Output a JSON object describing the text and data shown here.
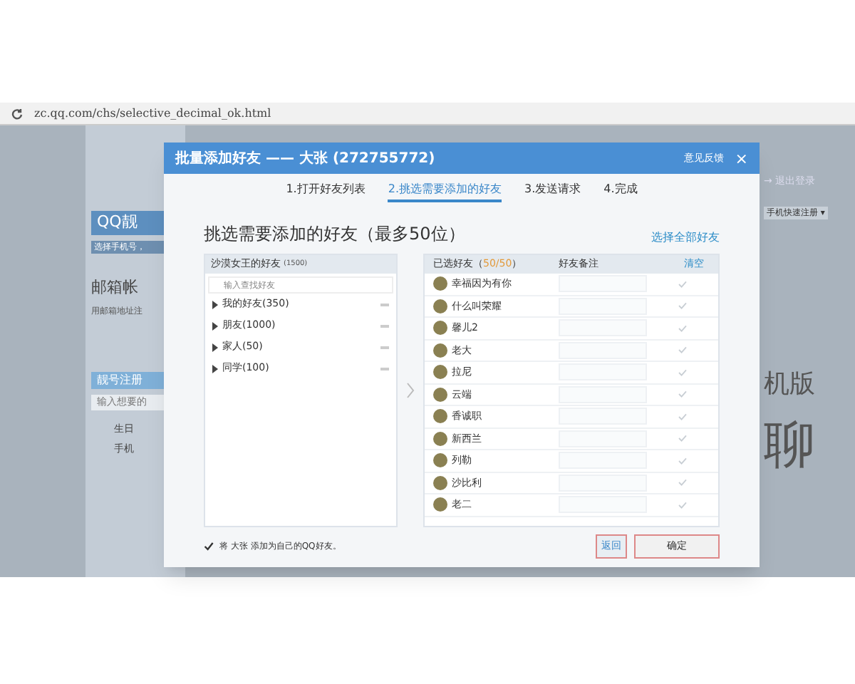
{
  "browser": {
    "url": "zc.qq.com/chs/selective_decimal_ok.html"
  },
  "background": {
    "left_title": "QQ靓",
    "left_sub": "选择手机号，",
    "mail_title": "邮箱帐",
    "mail_sub": "用邮箱地址注",
    "section": "靓号注册",
    "input_placeholder": "输入想要的",
    "birthday": "生日",
    "phone": "手机",
    "logout": "→ 退出登录",
    "phone_register": "手机快速注册 ▾",
    "promo_1": "机版",
    "promo_2": "聊"
  },
  "dialog": {
    "title": "批量添加好友 —— 大张 (272755772)",
    "feedback": "意见反馈",
    "close": "×",
    "steps": [
      {
        "label": "1.打开好友列表",
        "selected": false
      },
      {
        "label": "2.挑选需要添加的好友",
        "selected": true
      },
      {
        "label": "3.发送请求",
        "selected": false
      },
      {
        "label": "4.完成",
        "selected": false
      }
    ],
    "heading": "挑选需要添加的好友（最多50位）",
    "select_all": "选择全部好友",
    "left_panel": {
      "header": "沙漠女王的好友",
      "count": "(1500)",
      "search_placeholder": "输入查找好友",
      "groups": [
        {
          "label": "我的好友(350)",
          "expanded": false
        },
        {
          "label": "朋友(1000)",
          "expanded": false
        },
        {
          "label": "家人(50)",
          "expanded": false
        },
        {
          "label": "同学(100)",
          "expanded": false
        }
      ]
    },
    "right_panel": {
      "header_prefix": "已选好友（",
      "header_count": "50/50",
      "header_suffix": "）",
      "remark_column": "好友备注",
      "clear": "清空",
      "friends": [
        {
          "name": "幸福因为有你"
        },
        {
          "name": "什么叫荣耀"
        },
        {
          "name": "馨儿2"
        },
        {
          "name": "老大"
        },
        {
          "name": "拉尼"
        },
        {
          "name": "云端"
        },
        {
          "name": "香诚职"
        },
        {
          "name": "新西兰"
        },
        {
          "name": "列勒"
        },
        {
          "name": "沙比利"
        },
        {
          "name": "老二"
        }
      ]
    },
    "add_self": {
      "label": "将 大张 添加为自己的QQ好友。",
      "checked": true
    },
    "buttons": [
      "返回",
      "确定"
    ]
  }
}
